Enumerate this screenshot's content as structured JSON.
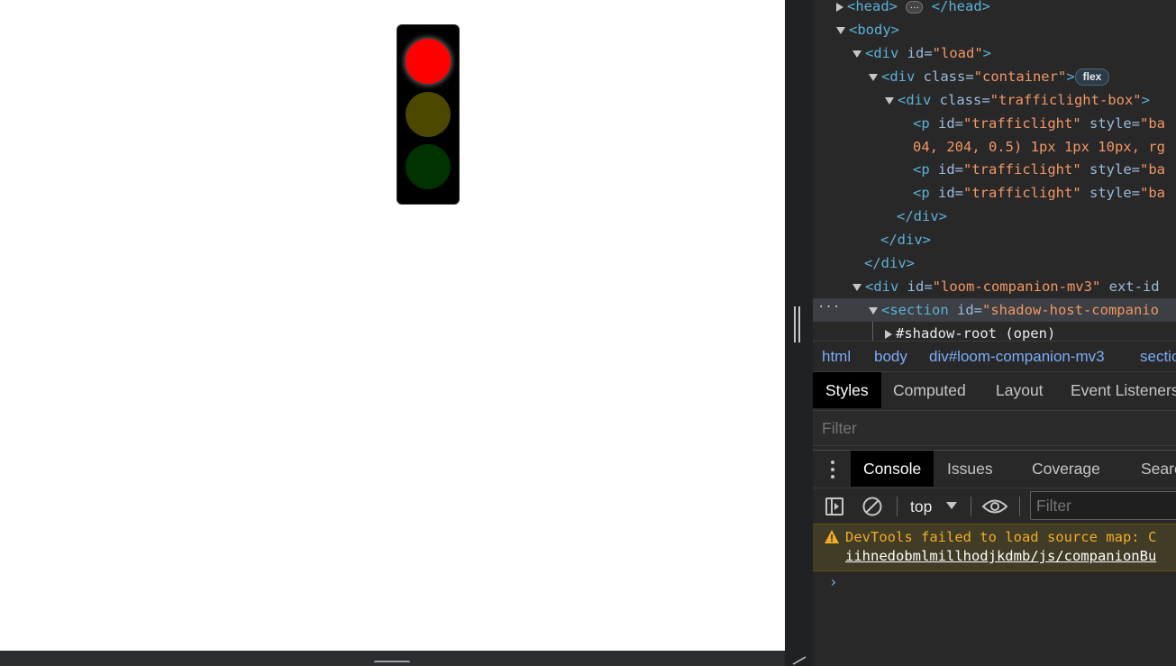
{
  "page": {
    "traffic_light": {
      "lamps": [
        {
          "name": "red",
          "color": "#ff0000",
          "on": true
        },
        {
          "name": "yellow",
          "color": "#4d4800",
          "on": false
        },
        {
          "name": "green",
          "color": "#003300",
          "on": false
        }
      ],
      "box_color": "#000000"
    }
  },
  "devtools": {
    "elements": {
      "lines": [
        {
          "open": "<head>",
          "badge": "…",
          "close": "</head>"
        },
        {
          "tag": "<body>"
        },
        {
          "tag_open": "<div",
          "attr": " id=",
          "val": "\"load\"",
          "tag_close": ">"
        },
        {
          "tag_open": "<div",
          "attr": " class=",
          "val": "\"container\"",
          "tag_close": ">",
          "badge": "flex"
        },
        {
          "tag_open": "<div",
          "attr": " class=",
          "val": "\"trafficlight-box\"",
          "tag_close": ">"
        },
        {
          "tag_open": "<p",
          "attr": " id=",
          "val": "\"trafficlight\"",
          "attr2": " style=",
          "val2": "\"ba"
        },
        {
          "cont": "04, 204, 0.5) 1px 1px 10px, rg"
        },
        {
          "tag_open": "<p",
          "attr": " id=",
          "val": "\"trafficlight\"",
          "attr2": " style=",
          "val2": "\"ba"
        },
        {
          "tag_open": "<p",
          "attr": " id=",
          "val": "\"trafficlight\"",
          "attr2": " style=",
          "val2": "\"ba"
        },
        {
          "tag": "</div>"
        },
        {
          "tag": "</div>"
        },
        {
          "tag": "</div>"
        },
        {
          "tag_open": "<div",
          "attr": " id=",
          "val": "\"loom-companion-mv3\"",
          "attr2": " ext-id"
        },
        {
          "tag_open": "<section",
          "attr": " id=",
          "val": "\"shadow-host-companio"
        },
        {
          "text": "#shadow-root (open)"
        }
      ],
      "row_dots": "···"
    },
    "breadcrumbs": [
      "html",
      "body",
      "div#loom-companion-mv3",
      "sectio"
    ],
    "panel_tabs": [
      "Styles",
      "Computed",
      "Layout",
      "Event Listeners"
    ],
    "styles_filter_placeholder": "Filter",
    "drawer_tabs": [
      "Console",
      "Issues",
      "Coverage",
      "Searc"
    ],
    "console": {
      "context": "top",
      "filter_placeholder": "Filter",
      "warning_text": "DevTools failed to load source map: C",
      "warning_link": "iihnedobmlmillhodjkdmb/js/companionBu",
      "prompt": "›"
    }
  }
}
